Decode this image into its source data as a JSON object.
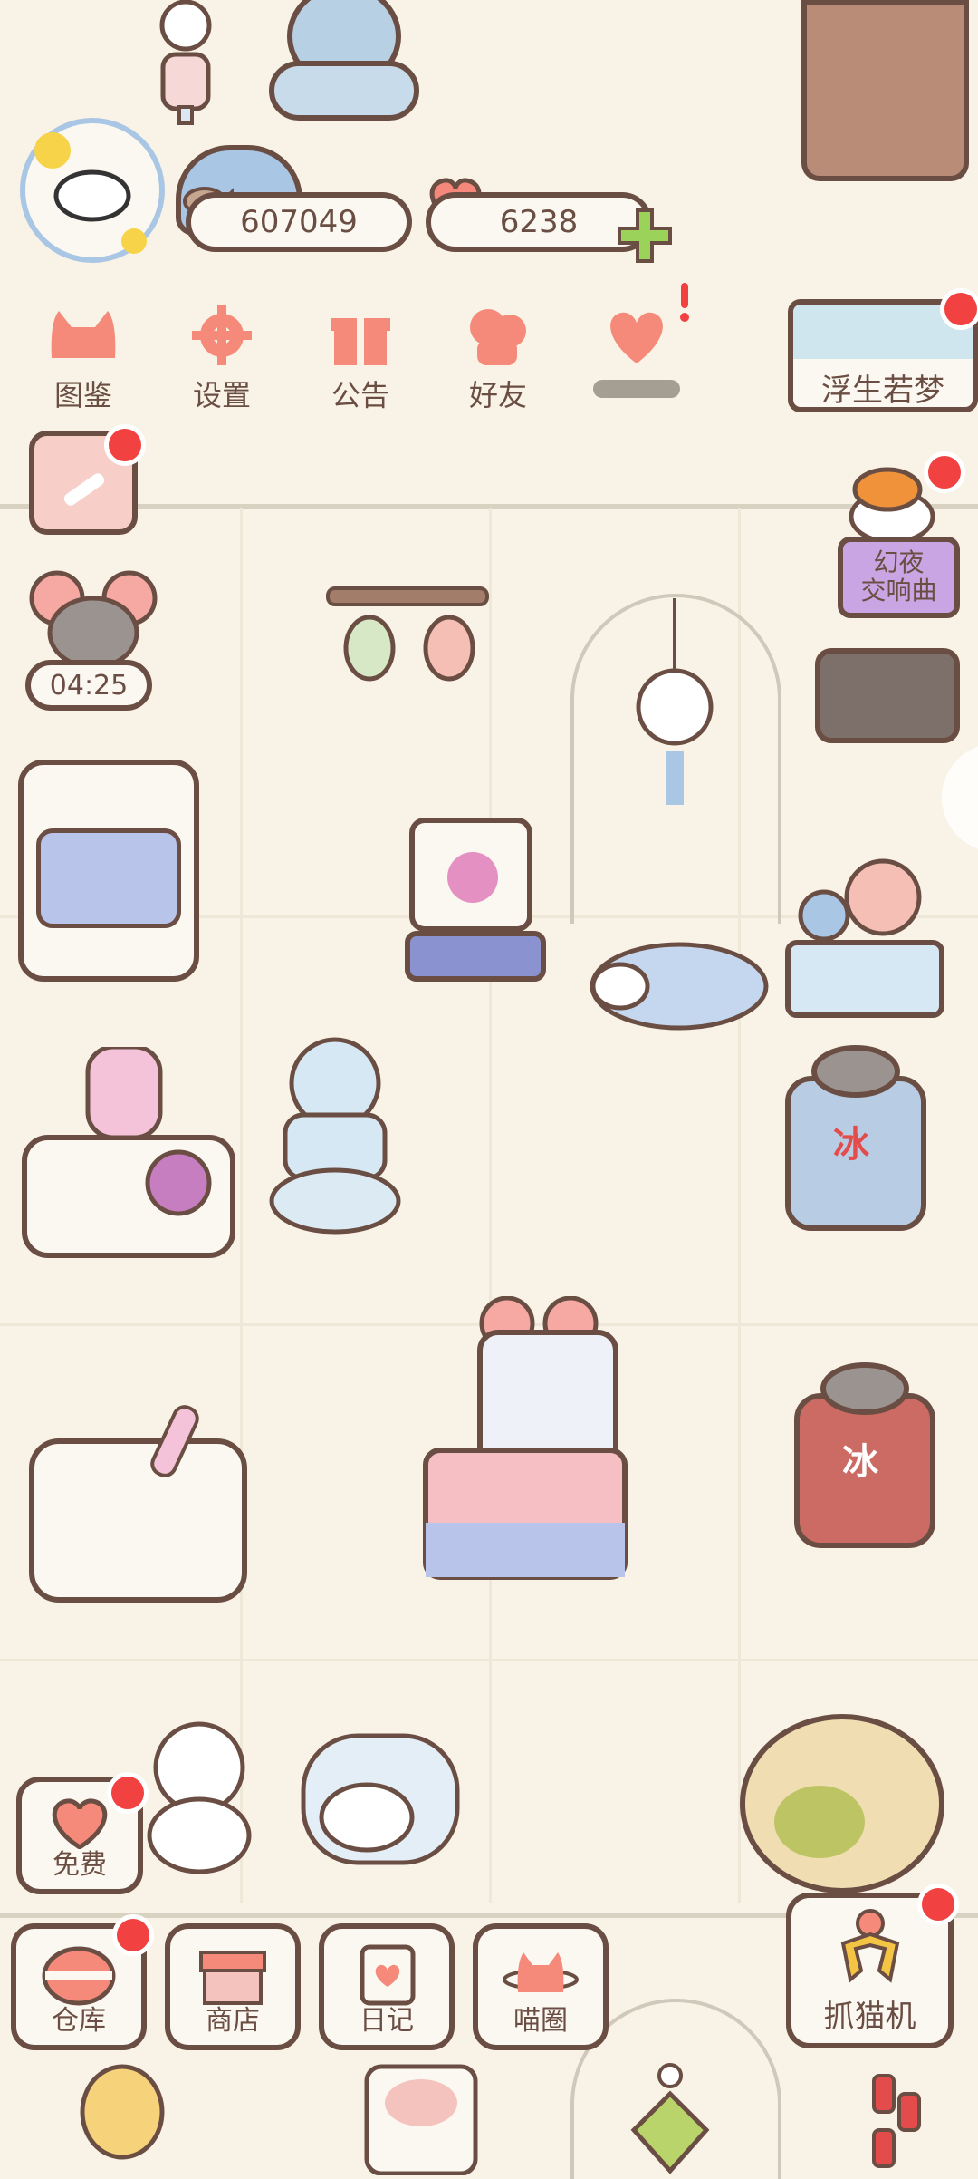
{
  "hud": {
    "fish_coins": "607049",
    "hearts": "6238"
  },
  "top_menu": [
    {
      "label": "图鉴",
      "icon": "cat-head-icon"
    },
    {
      "label": "设置",
      "icon": "gear-icon"
    },
    {
      "label": "公告",
      "icon": "gift-icon"
    },
    {
      "label": "好友",
      "icon": "friends-icon"
    },
    {
      "label": "",
      "icon": "heart-tap-icon"
    }
  ],
  "event_banner": {
    "label": "浮生若梦"
  },
  "event_sign": {
    "line1": "幻夜",
    "line2": "交响曲"
  },
  "timer": {
    "value": "04:25"
  },
  "free_button": {
    "label": "免费"
  },
  "bottom_nav": [
    {
      "label": "仓库",
      "icon": "storage-icon"
    },
    {
      "label": "商店",
      "icon": "shop-icon"
    },
    {
      "label": "日记",
      "icon": "diary-icon"
    },
    {
      "label": "喵圈",
      "icon": "cat-planet-icon"
    }
  ],
  "claw_machine_button": {
    "label": "抓猫机"
  },
  "ice_machine_text": "冰",
  "colors": {
    "background": "#f8f3e6",
    "outline": "#6b4e43",
    "accent_pink": "#f58a7a",
    "badge_red": "#f24141",
    "green_plus": "#9bd35a"
  }
}
